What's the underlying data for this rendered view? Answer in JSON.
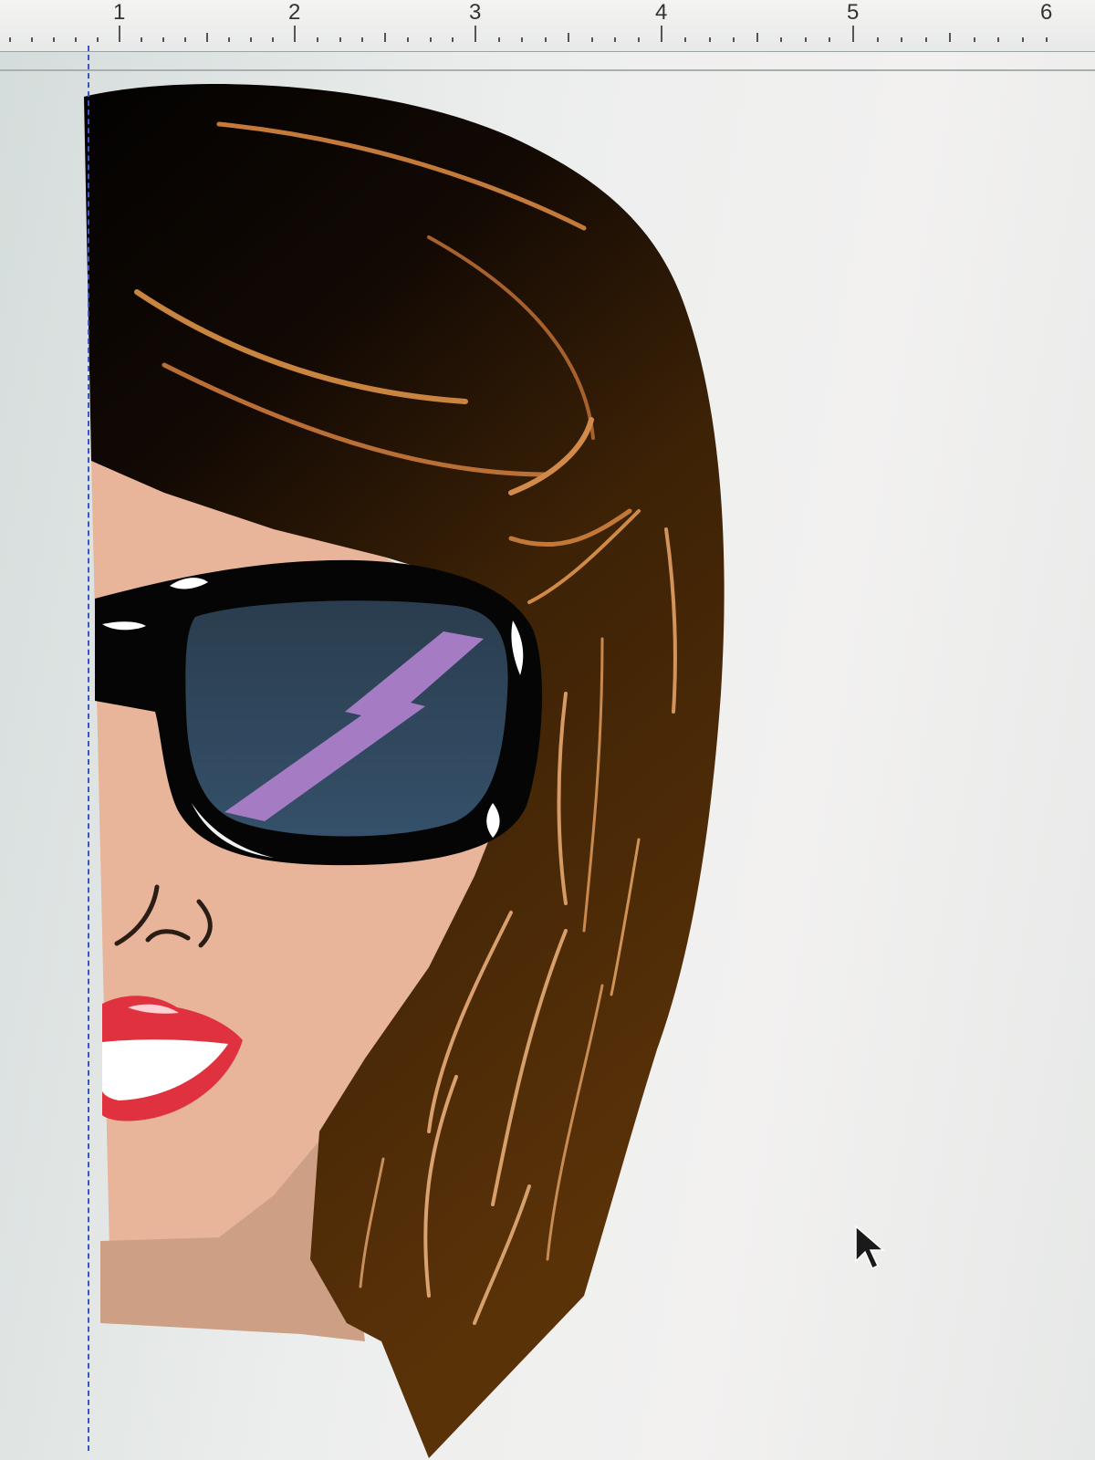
{
  "ruler": {
    "labels": [
      "1",
      "2",
      "3",
      "4",
      "5",
      "6"
    ]
  },
  "colors": {
    "background": "#eceeed",
    "hair_dark": "#0b0603",
    "hair_brown": "#5a3208",
    "hair_highlight": "#c9843f",
    "skin": "#e8b49a",
    "skin_shadow": "#cda086",
    "glasses_frame": "#050505",
    "lens": "#304557",
    "lens_reflection": "#a57cc4",
    "lips": "#e0323e",
    "guide": "#3b55c8"
  },
  "icons": {
    "cursor": "arrow-cursor-icon"
  }
}
